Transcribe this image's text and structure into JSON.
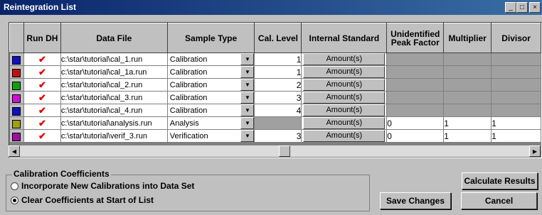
{
  "window": {
    "title": "Reintegration List"
  },
  "columns": [
    "Run DH",
    "Data File",
    "Sample Type",
    "Cal. Level",
    "Internal Standard",
    "Unidentified Peak Factor",
    "Multiplier",
    "Divisor"
  ],
  "rows": [
    {
      "color": "#1010c0",
      "file": "c:\\star\\tutorial\\cal_1.run",
      "type": "Calibration",
      "level": "1",
      "istd": "Amount(s)",
      "upf": "",
      "mult": "",
      "div": ""
    },
    {
      "color": "#c01010",
      "file": "c:\\star\\tutorial\\cal_1a.run",
      "type": "Calibration",
      "level": "1",
      "istd": "Amount(s)",
      "upf": "",
      "mult": "",
      "div": ""
    },
    {
      "color": "#10a010",
      "file": "c:\\star\\tutorial\\cal_2.run",
      "type": "Calibration",
      "level": "2",
      "istd": "Amount(s)",
      "upf": "",
      "mult": "",
      "div": ""
    },
    {
      "color": "#d010d0",
      "file": "c:\\star\\tutorial\\cal_3.run",
      "type": "Calibration",
      "level": "3",
      "istd": "Amount(s)",
      "upf": "",
      "mult": "",
      "div": ""
    },
    {
      "color": "#1010c0",
      "file": "c:\\star\\tutorial\\cal_4.run",
      "type": "Calibration",
      "level": "4",
      "istd": "Amount(s)",
      "upf": "",
      "mult": "",
      "div": ""
    },
    {
      "color": "#a0a010",
      "file": "c:\\star\\tutorial\\analysis.run",
      "type": "Analysis",
      "level": "",
      "istd": "Amount(s)",
      "upf": "0",
      "mult": "1",
      "div": "1"
    },
    {
      "color": "#a010a0",
      "file": "c:\\star\\tutorial\\verif_3.run",
      "type": "Verification",
      "level": "3",
      "istd": "Amount(s)",
      "upf": "0",
      "mult": "1",
      "div": "1"
    }
  ],
  "coefficients": {
    "legend": "Calibration Coefficients",
    "option1": "Incorporate New Calibrations into Data Set",
    "option2": "Clear Coefficients at Start of List",
    "selected": 2
  },
  "buttons": {
    "calculate": "Calculate Results",
    "save": "Save Changes",
    "cancel": "Cancel"
  }
}
